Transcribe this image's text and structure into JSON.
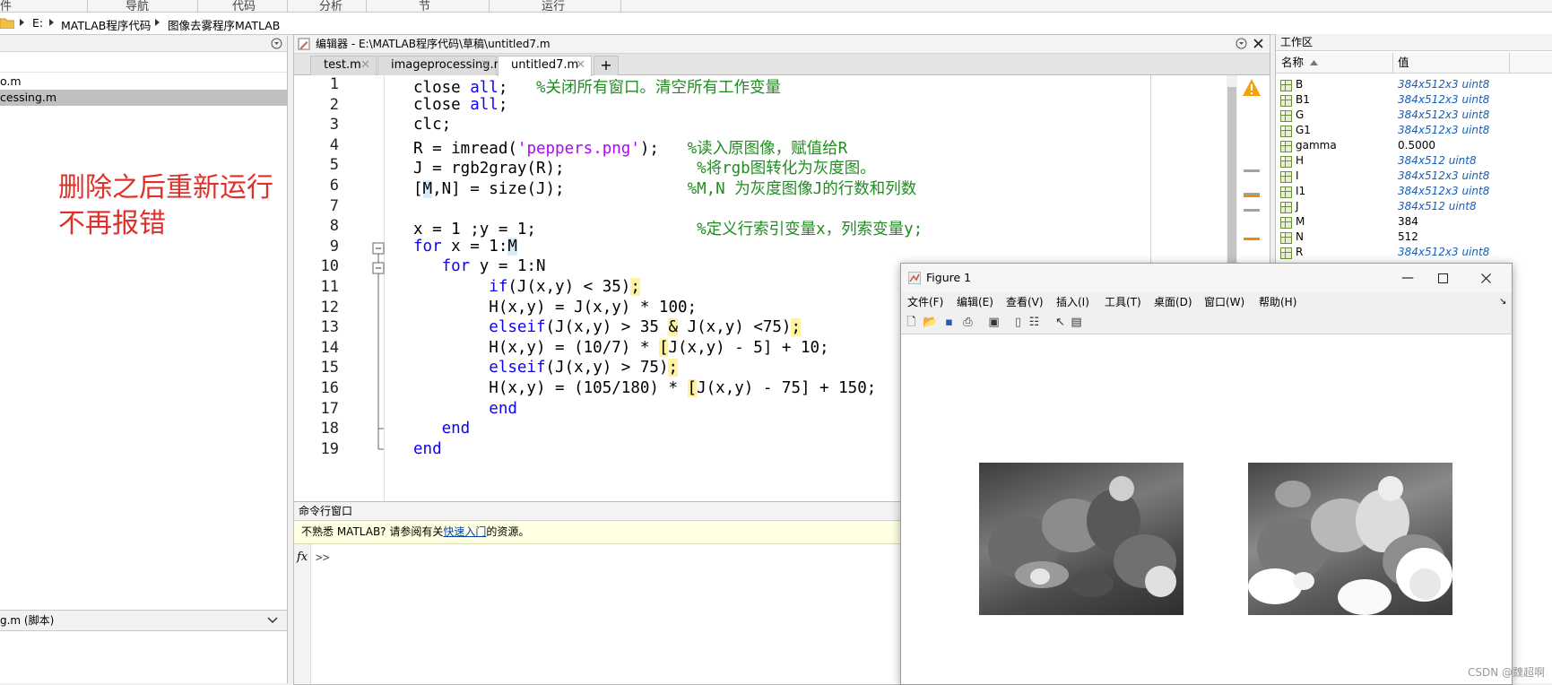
{
  "ribbon": {
    "sections": [
      "件",
      "导航",
      "代码",
      "分析",
      "节",
      "运行"
    ]
  },
  "address": {
    "drive": "E:",
    "parts": [
      "MATLAB程序代码",
      "图像去雾程序MATLAB"
    ]
  },
  "left_panel": {
    "files": [
      {
        "name": "o.m"
      },
      {
        "name": "cessing.m"
      }
    ],
    "note_line1": "删除之后重新运行",
    "note_line2": "不再报错",
    "details_label": "g.m  (脚本)"
  },
  "editor": {
    "title": "编辑器 - E:\\MATLAB程序代码\\草稿\\untitled7.m",
    "tabs": [
      {
        "label": "test.m"
      },
      {
        "label": "imageprocessing.m"
      },
      {
        "label": "untitled7.m"
      }
    ],
    "add_tab": "+",
    "line_numbers": [
      "1",
      "2",
      "3",
      "4",
      "5",
      "6",
      "7",
      "8",
      "9",
      "10",
      "11",
      "12",
      "13",
      "14",
      "15",
      "16",
      "17",
      "18",
      "19"
    ]
  },
  "command_window": {
    "title": "命令行窗口",
    "info_prefix": "不熟悉 MATLAB? 请参阅有关",
    "info_link": "快速入门",
    "info_suffix": "的资源。",
    "fx": "fx",
    "prompt": ">>"
  },
  "workspace": {
    "title": "工作区",
    "col_name": "名称",
    "col_value": "值",
    "variables": [
      {
        "name": "B",
        "value": "384x512x3 uint8"
      },
      {
        "name": "B1",
        "value": "384x512x3 uint8"
      },
      {
        "name": "G",
        "value": "384x512x3 uint8"
      },
      {
        "name": "G1",
        "value": "384x512x3 uint8"
      },
      {
        "name": "gamma",
        "value": "0.5000"
      },
      {
        "name": "H",
        "value": "384x512 uint8"
      },
      {
        "name": "I",
        "value": "384x512x3 uint8"
      },
      {
        "name": "I1",
        "value": "384x512x3 uint8"
      },
      {
        "name": "J",
        "value": "384x512 uint8"
      },
      {
        "name": "M",
        "value": "384"
      },
      {
        "name": "N",
        "value": "512"
      },
      {
        "name": "R",
        "value": "384x512x3 uint8"
      }
    ]
  },
  "figure": {
    "title": "Figure 1",
    "menu": [
      "文件(F)",
      "编辑(E)",
      "查看(V)",
      "插入(I)",
      "工具(T)",
      "桌面(D)",
      "窗口(W)",
      "帮助(H)"
    ]
  },
  "watermark": "CSDN @魏超啊",
  "colors": {
    "keyword": "#0e00ff",
    "string": "#a709f5",
    "comment": "#228b22",
    "note": "#e0302a",
    "warning": "#f0a30a"
  }
}
